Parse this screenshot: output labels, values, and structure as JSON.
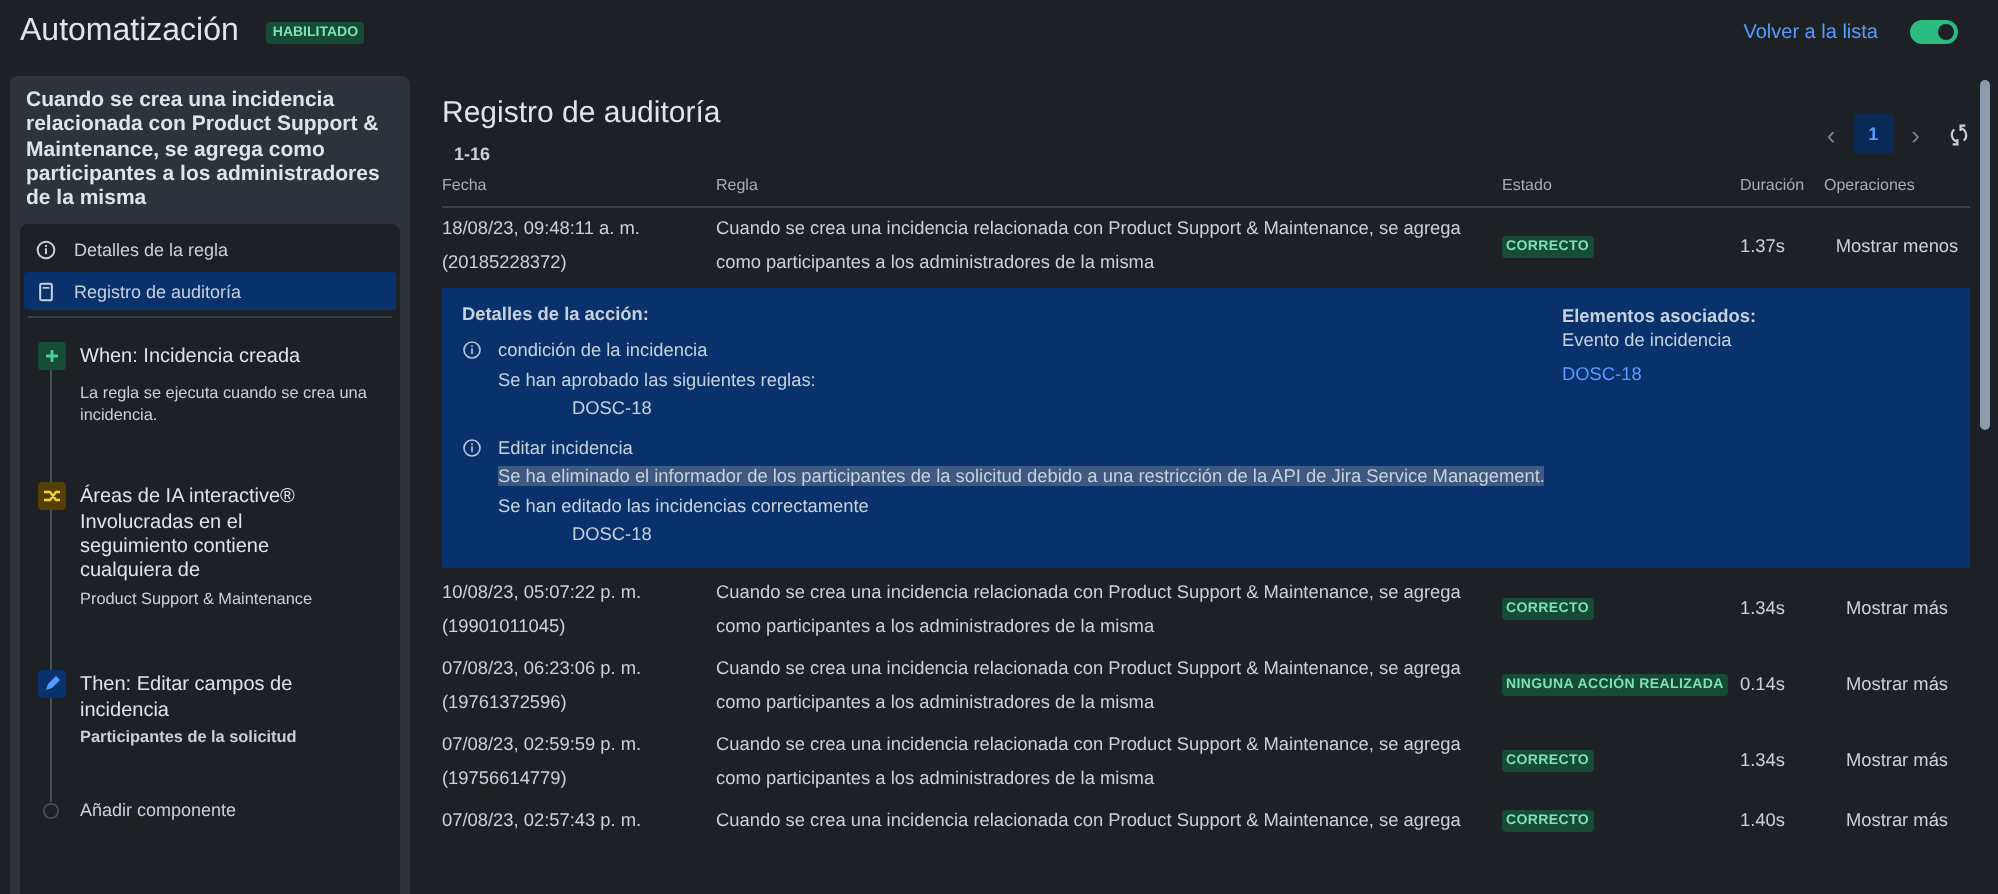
{
  "header": {
    "title": "Automatización",
    "badge": "HABILITADO",
    "back_link": "Volver a la lista",
    "toggle": {
      "on": true
    }
  },
  "sidebar": {
    "rule_title": "Cuando se crea una incidencia relacionada con Product Support & Maintenance, se agrega como participantes a los administradores de la misma",
    "nav": [
      {
        "label": "Detalles de la regla",
        "kind": "info",
        "selected": false
      },
      {
        "label": "Registro de auditoría",
        "kind": "log",
        "selected": true
      }
    ],
    "steps": [
      {
        "kind": "trigger",
        "title": "When: Incidencia creada",
        "detail": "La regla se ejecuta cuando se crea una incidencia."
      },
      {
        "kind": "condition",
        "title": "Áreas de IA interactive® Involucradas en el seguimiento contiene cualquiera de",
        "detail": "Product Support & Maintenance"
      },
      {
        "kind": "action",
        "title": "Then: Editar campos de incidencia",
        "detail": "Participantes de la solicitud"
      },
      {
        "kind": "add",
        "title": "Añadir componente"
      }
    ]
  },
  "main": {
    "title": "Registro de auditoría",
    "range": "1-16",
    "pagination": {
      "prev": "‹",
      "page": "1",
      "next": "›"
    },
    "table": {
      "columns": [
        "Fecha",
        "Regla",
        "Estado",
        "Duración",
        "Operaciones"
      ],
      "rows": [
        {
          "date": "18/08/23, 09:48:11 a. m.",
          "id": "(20185228372)",
          "rule_lines": [
            "Cuando se crea una incidencia relacionada con Product Support & Maintenance, se agrega",
            "como participantes a los administradores de la misma"
          ],
          "status": "CORRECTO",
          "duration": "1.37s",
          "operation": "Mostrar menos",
          "details": {
            "heading": "Detalles de la acción:",
            "items": [
              {
                "title": "condición de la incidencia",
                "lines": [
                  {
                    "text": "Se han aprobado las siguientes reglas:",
                    "highlighted": false
                  }
                ],
                "issue": "DOSC-18"
              },
              {
                "title": "Editar incidencia",
                "lines": [
                  {
                    "text": "Se ha eliminado el informador de los participantes de la solicitud debido a una restricción de la API de Jira Service Management.",
                    "highlighted": true
                  },
                  {
                    "text": "Se han editado las incidencias correctamente",
                    "highlighted": false
                  }
                ],
                "issue": "DOSC-18"
              }
            ],
            "associated_heading": "Elementos asociados:",
            "associated_type": "Evento de incidencia",
            "associated_link": "DOSC-18"
          }
        },
        {
          "date": "10/08/23, 05:07:22 p. m.",
          "id": "(19901011045)",
          "rule_lines": [
            "Cuando se crea una incidencia relacionada con Product Support & Maintenance, se agrega",
            "como participantes a los administradores de la misma"
          ],
          "status": "CORRECTO",
          "duration": "1.34s",
          "operation": "Mostrar más"
        },
        {
          "date": "07/08/23, 06:23:06 p. m.",
          "id": "(19761372596)",
          "rule_lines": [
            "Cuando se crea una incidencia relacionada con Product Support & Maintenance, se agrega",
            "como participantes a los administradores de la misma"
          ],
          "status": "NINGUNA ACCIÓN REALIZADA",
          "duration": "0.14s",
          "operation": "Mostrar más"
        },
        {
          "date": "07/08/23, 02:59:59 p. m.",
          "id": "(19756614779)",
          "rule_lines": [
            "Cuando se crea una incidencia relacionada con Product Support & Maintenance, se agrega",
            "como participantes a los administradores de la misma"
          ],
          "status": "CORRECTO",
          "duration": "1.34s",
          "operation": "Mostrar más"
        },
        {
          "date": "07/08/23, 02:57:43 p. m.",
          "rule_lines": [
            "Cuando se crea una incidencia relacionada con Product Support & Maintenance, se agrega"
          ],
          "status": "CORRECTO",
          "duration": "1.40s",
          "operation": "Mostrar más"
        }
      ]
    }
  }
}
